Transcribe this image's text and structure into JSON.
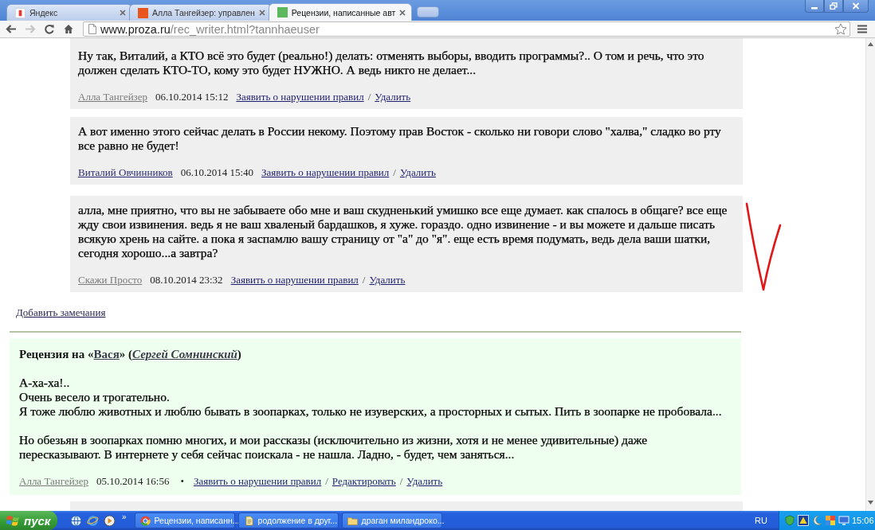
{
  "browser": {
    "tabs": [
      {
        "title": "Яндекс",
        "selected": false,
        "kind": "framed",
        "color": "#e23a2e"
      },
      {
        "title": "Алла Тангейзер: управлен",
        "selected": false,
        "kind": "solid",
        "color": "#e8561e"
      },
      {
        "title": "Рецензии, написанные авт",
        "selected": true,
        "kind": "solid",
        "color": "#5cb85c"
      }
    ],
    "nav": [
      {
        "kind": "back",
        "disabled": false
      },
      {
        "kind": "forward",
        "disabled": true
      },
      {
        "kind": "reload",
        "disabled": false
      },
      {
        "kind": "home",
        "disabled": false
      }
    ],
    "address": {
      "host": "www.proza.ru",
      "path": "/rec_writer.html?tannhaeuser"
    }
  },
  "comments": [
    {
      "text": "Ну так, Виталий, а КТО всё это будет (реально!) делать: отменять выборы, вводить программы?.. О том и речь, что это должен сделать КТО-ТО, кому это будет НУЖНО. А ведь никто не делает...",
      "author": {
        "name": "Алла Тангейзер",
        "color": "#7a7a7a"
      },
      "date": "06.10.2014 15:12",
      "actions": [
        {
          "label": "Заявить о нарушении правил"
        },
        {
          "label": "Удалить",
          "separator": "/"
        }
      ]
    },
    {
      "text": "А вот именно этого сейчас делать в России некому. Поэтому прав Восток - сколько ни говори слово \"халва,\" сладко во рту все равно не будет!",
      "author": {
        "name": "Виталий Овчинников",
        "color": "#2a2a6e"
      },
      "date": "06.10.2014 15:40",
      "actions": [
        {
          "label": "Заявить о нарушении правил"
        },
        {
          "label": "Удалить",
          "separator": "/"
        }
      ]
    },
    {
      "text": "алла, мне приятно, что вы не забываете обо мне и ваш скудненький умишко все еще думает. как спалось в общаге? все еще жду свои извинения. ведь я не ваш хваленый бардашков, я хуже. гораздо. одно извинение - и вы можете и дальше писать всякую хрень на сайте. а пока я заспамлю вашу страницу от \"а\" до \"я\". еще есть время подумать, ведь дела ваши шатки, сегодня хорошо...а завтра?",
      "author": {
        "name": "Скажи Просто",
        "color": "#7a7a7a"
      },
      "date": "08.10.2014 23:32",
      "actions": [
        {
          "label": "Заявить о нарушении правил"
        },
        {
          "label": "Удалить",
          "separator": "/"
        }
      ]
    }
  ],
  "add_remark": "Добавить замечания",
  "review": {
    "heading": {
      "prefix": "Рецензия на «",
      "work": "Вася",
      "middle": "» (",
      "author": "Сергей Сомнинский",
      "suffix": ")"
    },
    "paragraphs": [
      [
        "А-ха-ха!..",
        "Очень весело и трогательно.",
        "Я тоже люблю животных и люблю бывать в зоопарках, только не изуверских, а просторных и сытых. Пить в зоопарке не пробовала..."
      ],
      [
        "Но обезьян в зоопарках помню многих, и мои рассказы (исключительно из жизни, хотя и не менее удивительные) даже пересказывают. В интернете у себя сейчас поискала - не нашла. Ладно, - будет, чем заняться..."
      ]
    ],
    "author": {
      "name": "Алла Тангейзер",
      "color": "#7a7a7a"
    },
    "date": "05.10.2014 16:56",
    "bullet": "•",
    "actions": [
      {
        "label": "Заявить о нарушении правил"
      },
      {
        "label": "Редактировать",
        "separator": "/"
      },
      {
        "label": "Удалить",
        "separator": "/"
      }
    ]
  },
  "taskbar": {
    "start": "пуск",
    "more": "»",
    "tasks": [
      {
        "label": "Рецензии, написанн...",
        "kind": "browser"
      },
      {
        "label": "родолжение в друг...",
        "kind": "document"
      },
      {
        "label": "драган миландроко...",
        "kind": "folder"
      }
    ],
    "language": "RU",
    "clock": "15:06"
  }
}
